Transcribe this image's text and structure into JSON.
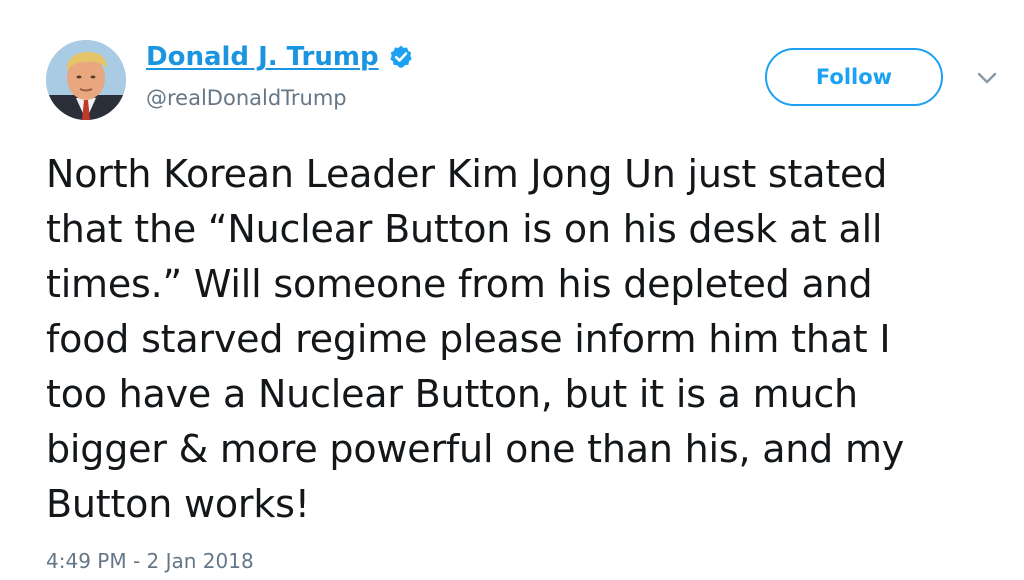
{
  "author": {
    "display_name": "Donald J. Trump",
    "handle": "@realDonaldTrump",
    "verified": true,
    "avatar_icon": "profile-photo-avatar"
  },
  "actions": {
    "follow_label": "Follow",
    "more_menu_icon": "chevron-down-icon"
  },
  "tweet": {
    "lines": [
      "North Korean Leader Kim Jong Un just stated",
      "that the “Nuclear Button is on his desk at all",
      "times.” Will someone from his depleted and",
      "food starved regime please inform him that I",
      "too have a Nuclear Button, but it is a much",
      "bigger & more powerful one than his, and my",
      "Button works!"
    ],
    "timestamp": "4:49 PM - 2 Jan 2018"
  },
  "colors": {
    "link_blue": "#1b95e0",
    "follow_blue": "#1da1f2",
    "muted_gray": "#657786",
    "text": "#14171a"
  }
}
